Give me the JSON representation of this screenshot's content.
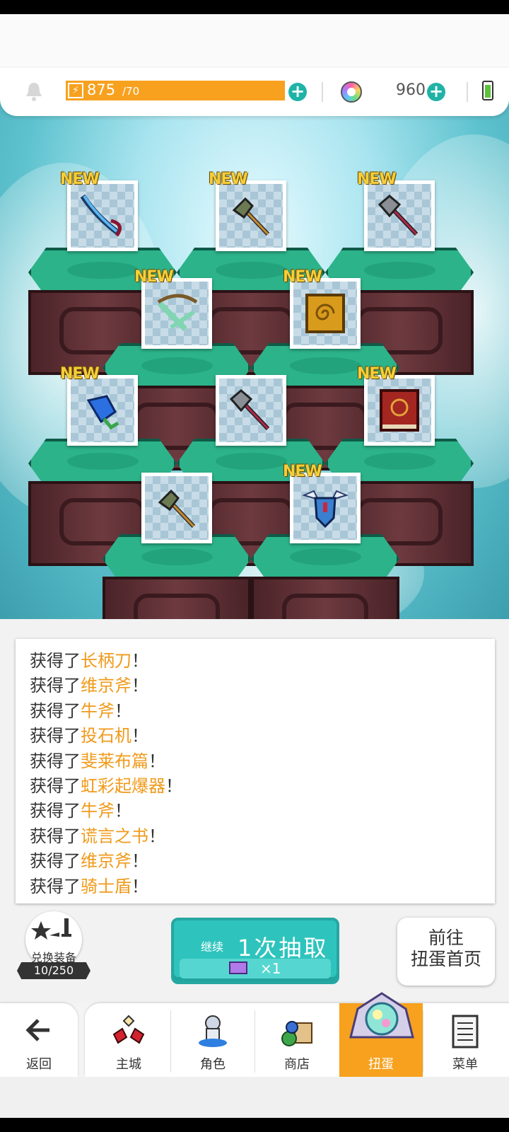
{
  "header": {
    "energy_current": "875",
    "energy_max": "/70",
    "gem_count": "960",
    "icons": [
      "bell-icon",
      "lightning-icon",
      "plus-icon",
      "rainbow-gem-icon",
      "battery-icon"
    ]
  },
  "items": [
    {
      "new": "NEW",
      "icon": "glaive-icon"
    },
    {
      "new": "NEW",
      "icon": "viking-axe-icon"
    },
    {
      "new": "NEW",
      "icon": "ox-axe-icon"
    },
    {
      "new": "NEW",
      "icon": "catapult-icon"
    },
    {
      "new": "NEW",
      "icon": "fibonacci-book-icon"
    },
    {
      "new": "NEW",
      "icon": "rainbow-blaster-icon"
    },
    {
      "new": "",
      "icon": "ox-axe-icon"
    },
    {
      "new": "NEW",
      "icon": "book-of-lies-icon"
    },
    {
      "new": "",
      "icon": "viking-axe-icon"
    },
    {
      "new": "NEW",
      "icon": "knight-shield-icon"
    }
  ],
  "log": {
    "prefix": "获得了",
    "suffix": "！",
    "entries": [
      "长柄刀",
      "维京斧",
      "牛斧",
      "投石机",
      "斐莱布篇",
      "虹彩起爆器",
      "牛斧",
      "谎言之书",
      "维京斧",
      "骑士盾"
    ]
  },
  "exchange": {
    "label": "兑换装备",
    "count": "10/250"
  },
  "draw_button": {
    "continue_label": "继续",
    "main_label": "1次抽取",
    "ticket_multiplier": "×1"
  },
  "home_button": {
    "line1": "前往",
    "line2": "扭蛋首页"
  },
  "nav": {
    "back": "返回",
    "tabs": [
      "主城",
      "角色",
      "商店",
      "扭蛋",
      "菜单"
    ],
    "active_tab": "扭蛋"
  },
  "colors": {
    "accent_orange": "#f7a11e",
    "teal": "#2ec4bd",
    "item_name": "#f09a1a"
  }
}
